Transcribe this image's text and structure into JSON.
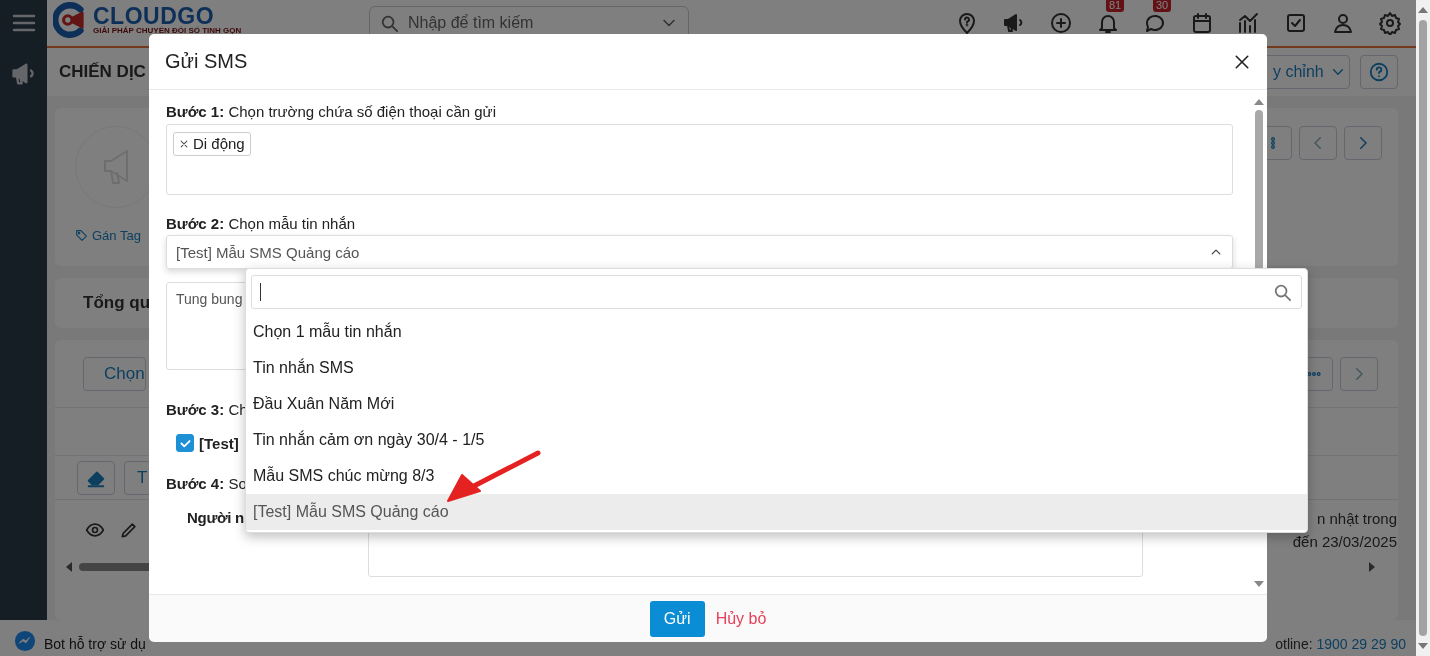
{
  "header": {
    "logo": {
      "name": "CLOUDGO",
      "tagline": "GIẢI PHÁP CHUYỂN ĐỔI SỐ TINH GỌN"
    },
    "search": {
      "placeholder": "Nhập để tìm kiếm"
    },
    "icons": [
      {
        "kind": "location"
      },
      {
        "kind": "megaphone"
      },
      {
        "kind": "add"
      },
      {
        "kind": "bell",
        "badge": "81"
      },
      {
        "kind": "chat",
        "badge": "30"
      },
      {
        "kind": "calendar"
      },
      {
        "kind": "chart"
      },
      {
        "kind": "task"
      },
      {
        "kind": "user"
      },
      {
        "kind": "settings"
      }
    ]
  },
  "page": {
    "title": "CHIẾN DỊC",
    "customize_button": "y chỉnh",
    "tag_link": "Gán Tag",
    "overview_title": "Tổng qu",
    "choose_button": "Chọn",
    "toolbar_button": "T",
    "update_note": "n nhật trong",
    "update_date": "đến 23/03/2025"
  },
  "status_bar": {
    "bot_text": "Bot hỗ trợ sử dụ",
    "hotline_label": "otline:",
    "hotline_number": "1900 29 29 90"
  },
  "dialog": {
    "title": "Gửi SMS",
    "steps": [
      {
        "label": "Bước 1:",
        "text": "Chọn trường chứa số điện thoại cần gửi",
        "kind": "tags",
        "tags": [
          "Di động"
        ]
      },
      {
        "label": "Bước 2:",
        "text": "Chọn mẫu tin nhắn",
        "kind": "select",
        "value": "[Test] Mẫu SMS Quảng cáo",
        "expanded": true,
        "preview": "Tung bung",
        "options": [
          {
            "label": "Chọn 1 mẫu tin nhắn",
            "selected": false
          },
          {
            "label": "Tin nhắn SMS",
            "selected": false
          },
          {
            "label": "Đầu Xuân Năm Mới",
            "selected": false
          },
          {
            "label": "Tin nhắn cảm ơn ngày 30/4 - 1/5",
            "selected": false
          },
          {
            "label": "Mẫu SMS chúc mừng 8/3",
            "selected": false
          },
          {
            "label": "[Test] Mẫu SMS Quảng cáo",
            "selected": true
          }
        ]
      },
      {
        "label": "Bước 3:",
        "text": "Ch",
        "kind": "checkbox",
        "option": {
          "label": "[Test]",
          "checked": true
        }
      },
      {
        "label": "Bước 4:",
        "text": "So",
        "kind": "recipients",
        "field_label": "Người n"
      }
    ],
    "buttons": {
      "send": "Gửi",
      "cancel": "Hủy bỏ"
    }
  }
}
